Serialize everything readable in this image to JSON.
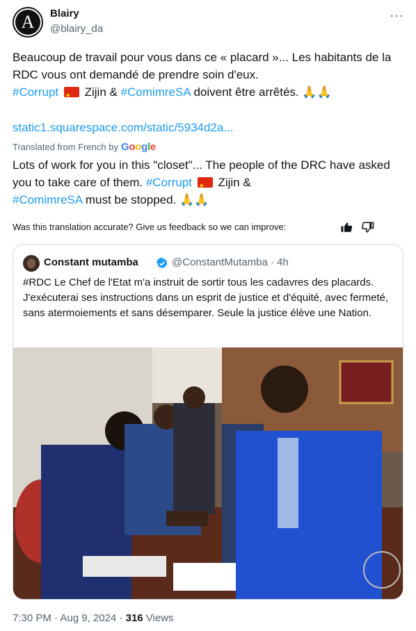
{
  "author": {
    "name": "Blairy",
    "handle": "@blairy_da",
    "avatar_letter": "A"
  },
  "more_label": "···",
  "tweet": {
    "part1": "Beaucoup de travail pour vous dans ce « placard »... Les habitants de la RDC vous ont demandé de prendre soin d'eux.",
    "hashtag1": "#Corrupt",
    "middle": "Zijin &",
    "hashtag2": "#ComimreSA",
    "part2": "doivent être arrêtés.",
    "emoji": "🙏🙏",
    "link": "static1.squarespace.com/static/5934d2a..."
  },
  "translated_label": "Translated from French by",
  "google_letters": [
    "G",
    "o",
    "o",
    "g",
    "l",
    "e"
  ],
  "translation": {
    "part1": "Lots of work for you in this \"closet\"... The people of the DRC have asked you to take care of them.",
    "hashtag1": "#Corrupt",
    "middle": "Zijin &",
    "hashtag2": "#ComimreSA",
    "part2": "must be stopped.",
    "emoji": "🙏🙏"
  },
  "feedback_text": "Was this translation accurate? Give us feedback so we can improve:",
  "quote": {
    "name": "Constant mutamba",
    "handle": "@ConstantMutamba · 4h",
    "text": "#RDC Le Chef de l'Etat m'a instruit de sortir tous les cadavres des placards. J'exécuterai ses instructions dans un esprit de justice et d'équité, avec fermeté, sans atermoiements et sans désemparer. Seule la justice élève une Nation."
  },
  "meta": {
    "time": "7:30 PM · Aug 9, 2024 · ",
    "views_count": "316",
    "views_label": " Views"
  },
  "colors": {
    "accent": "#1d9bf0",
    "muted": "#536471",
    "border": "#cfd9de"
  }
}
